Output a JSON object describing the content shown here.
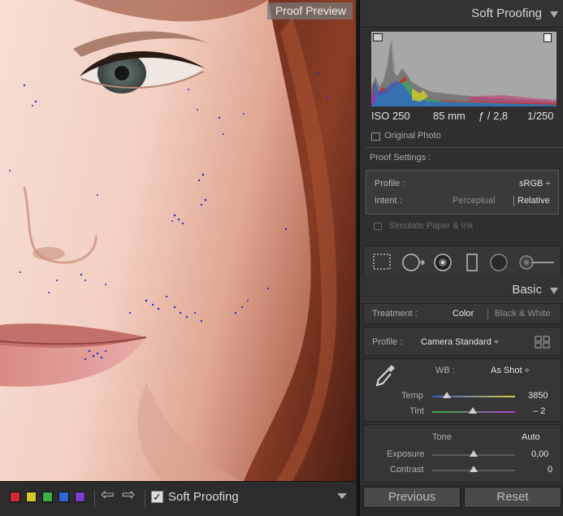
{
  "photo": {
    "overlay_label": "Proof Preview"
  },
  "toolbar": {
    "swatch_colors": [
      "#d32b36",
      "#d4c928",
      "#3eb143",
      "#2f67d5",
      "#7b3fd0"
    ],
    "prev_icon": "left-arrow-icon",
    "next_icon": "right-arrow-icon",
    "soft_proofing_checked": "✓",
    "soft_proofing_label": "Soft Proofing"
  },
  "panel": {
    "soft_proofing_title": "Soft Proofing",
    "exif": {
      "iso": "ISO 250",
      "focal": "85 mm",
      "aperture": "ƒ / 2,8",
      "shutter": "1/250"
    },
    "original_photo_label": "Original Photo",
    "proof_settings_label": "Proof Settings :",
    "profile_label": "Profile :",
    "profile_value": "sRGB ÷",
    "intent_label": "Intent :",
    "intent_options": [
      "Perceptual",
      "Relative"
    ],
    "intent_selected": "Relative",
    "simulate_label": "Simulate Paper & Ink",
    "basic_title": "Basic",
    "treatment_label": "Treatment :",
    "treatment_options": [
      "Color",
      "Black & White"
    ],
    "treatment_selected": "Color",
    "basic_profile_label": "Profile :",
    "basic_profile_value": "Camera Standard ÷",
    "wb_label": "WB :",
    "wb_value": "As Shot ÷",
    "temp_label": "Temp",
    "temp_value": "3850",
    "temp_level": 0.18,
    "tint_label": "Tint",
    "tint_value": "– 2",
    "tint_level": 0.49,
    "tone_label": "Tone",
    "auto_label": "Auto",
    "exposure_label": "Exposure",
    "exposure_value": "0,00",
    "exposure_level": 0.5,
    "contrast_label": "Contrast",
    "contrast_value": "0",
    "contrast_level": 0.5,
    "previous_label": "Previous",
    "reset_label": "Reset"
  }
}
